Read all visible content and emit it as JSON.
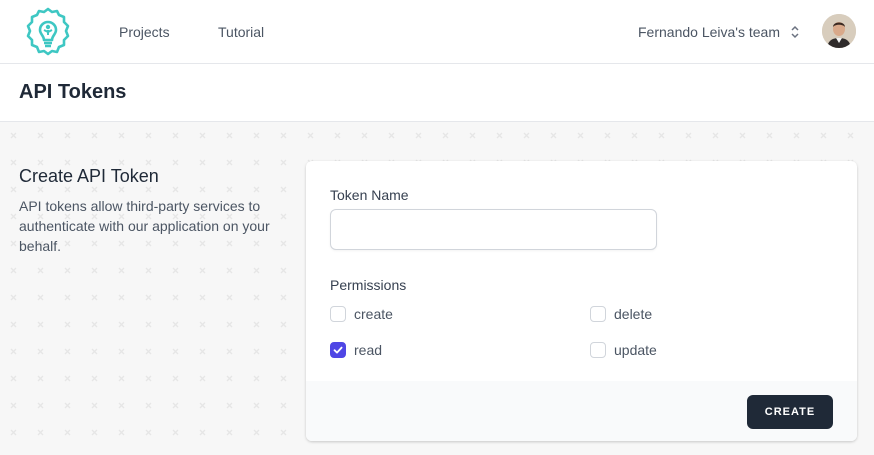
{
  "nav": {
    "logo_icon": "lightbulb-gear-logo",
    "links": [
      "Projects",
      "Tutorial"
    ],
    "team_name": "Fernando Leiva's team",
    "team_chevron_icon": "chevron-up-down-icon",
    "avatar_icon": "user-avatar"
  },
  "header": {
    "title": "API Tokens"
  },
  "intro": {
    "title": "Create API Token",
    "description": "API tokens allow third-party services to authenticate with our application on your behalf."
  },
  "form": {
    "token_name_label": "Token Name",
    "token_name_value": "",
    "permissions_label": "Permissions",
    "permissions": [
      {
        "label": "create",
        "checked": false
      },
      {
        "label": "delete",
        "checked": false
      },
      {
        "label": "read",
        "checked": true
      },
      {
        "label": "update",
        "checked": false
      }
    ],
    "create_label": "CREATE"
  },
  "colors": {
    "accent": "#4f46e5",
    "button": "#1f2937",
    "logo": "#3ec7c3"
  }
}
